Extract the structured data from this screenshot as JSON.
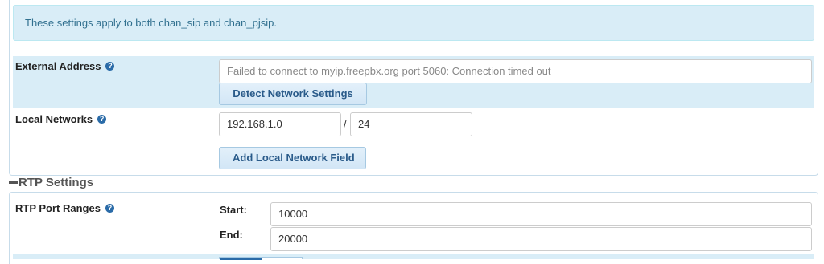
{
  "info_text": "These settings apply to both chan_sip and chan_pjsip.",
  "external_address": {
    "label": "External Address",
    "help": "?",
    "placeholder": "Failed to connect to myip.freepbx.org port 5060: Connection timed out",
    "detect_button": "Detect Network Settings"
  },
  "local_networks": {
    "label": "Local Networks",
    "help": "?",
    "ip": "192.168.1.0",
    "separator": "/",
    "mask": "24",
    "add_button": "Add Local Network Field"
  },
  "rtp_section": {
    "title": "RTP Settings",
    "port_ranges_label": "RTP Port Ranges",
    "help": "?",
    "start_label": "Start:",
    "start_value": "10000",
    "end_label": "End:",
    "end_value": "20000"
  },
  "colors": {
    "info_bg": "#d9edf7",
    "info_text": "#31708f",
    "accent": "#2a6ba8"
  }
}
